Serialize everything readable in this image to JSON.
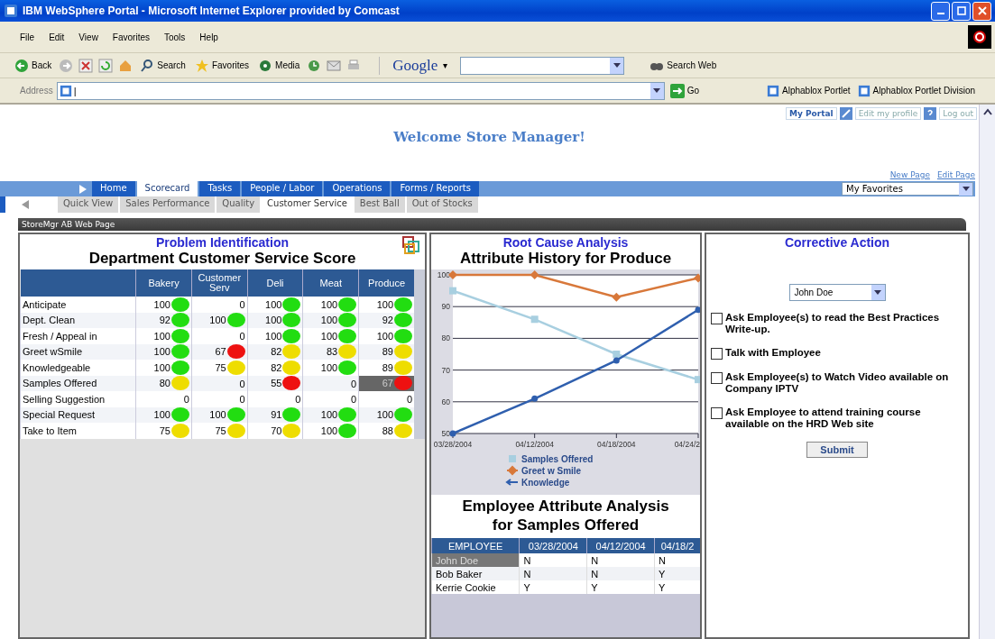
{
  "window": {
    "title": "IBM WebSphere Portal - Microsoft Internet Explorer provided by Comcast"
  },
  "menu": [
    "File",
    "Edit",
    "View",
    "Favorites",
    "Tools",
    "Help"
  ],
  "toolbar": {
    "back": "Back",
    "search": "Search",
    "favorites": "Favorites",
    "media": "Media",
    "google": "Google",
    "google_caret": "▾",
    "search_web": "Search Web"
  },
  "address": {
    "label": "Address",
    "value": "|",
    "go": "Go",
    "links": [
      "Alphablox Portlet",
      "Alphablox Portlet Division"
    ]
  },
  "portal": {
    "top_links": [
      "My Portal",
      "Edit my profile",
      "Log out"
    ],
    "welcome": "Welcome Store Manager!",
    "page_links": [
      "New Page",
      "Edit Page"
    ],
    "nav": [
      {
        "label": "Home",
        "selected": false
      },
      {
        "label": "Scorecard",
        "selected": true
      },
      {
        "label": "Tasks",
        "selected": false
      },
      {
        "label": "People / Labor",
        "selected": false
      },
      {
        "label": "Operations",
        "selected": false
      },
      {
        "label": "Forms / Reports",
        "selected": false
      }
    ],
    "favorites": "My Favorites",
    "subnav": [
      {
        "label": "Quick View",
        "selected": false
      },
      {
        "label": "Sales Performance",
        "selected": false
      },
      {
        "label": "Quality",
        "selected": false
      },
      {
        "label": "Customer Service",
        "selected": true
      },
      {
        "label": "Best Ball",
        "selected": false
      },
      {
        "label": "Out of Stocks",
        "selected": false
      }
    ],
    "portlet_title": "StoreMgr AB Web Page"
  },
  "score": {
    "section_title": "Problem Identification",
    "title": "Department Customer Service Score",
    "columns": [
      "Bakery",
      "Customer Serv",
      "Deli",
      "Meat",
      "Produce"
    ],
    "rows": [
      {
        "label": "Anticipate",
        "cells": [
          {
            "value": "100",
            "color": "#22dd11",
            "selected": false
          },
          {
            "value": "0",
            "selected": false
          },
          {
            "value": "100",
            "color": "#22dd11",
            "selected": false
          },
          {
            "value": "100",
            "color": "#22dd11",
            "selected": false
          },
          {
            "value": "100",
            "color": "#22dd11",
            "selected": false
          }
        ]
      },
      {
        "label": "Dept. Clean",
        "cells": [
          {
            "value": "92",
            "color": "#22dd11",
            "selected": false
          },
          {
            "value": "100",
            "color": "#22dd11",
            "selected": false
          },
          {
            "value": "100",
            "color": "#22dd11",
            "selected": false
          },
          {
            "value": "100",
            "color": "#22dd11",
            "selected": false
          },
          {
            "value": "92",
            "color": "#22dd11",
            "selected": false
          }
        ]
      },
      {
        "label": "Fresh / Appeal in",
        "cells": [
          {
            "value": "100",
            "color": "#22dd11",
            "selected": false
          },
          {
            "value": "0",
            "selected": false
          },
          {
            "value": "100",
            "color": "#22dd11",
            "selected": false
          },
          {
            "value": "100",
            "color": "#22dd11",
            "selected": false
          },
          {
            "value": "100",
            "color": "#22dd11",
            "selected": false
          }
        ]
      },
      {
        "label": "Greet wSmile",
        "cells": [
          {
            "value": "100",
            "color": "#22dd11",
            "selected": false
          },
          {
            "value": "67",
            "color": "#ee1111",
            "selected": false
          },
          {
            "value": "82",
            "color": "#eedd00",
            "selected": false
          },
          {
            "value": "83",
            "color": "#eedd00",
            "selected": false
          },
          {
            "value": "89",
            "color": "#eedd00",
            "selected": false
          }
        ]
      },
      {
        "label": "Knowledgeable",
        "cells": [
          {
            "value": "100",
            "color": "#22dd11",
            "selected": false
          },
          {
            "value": "75",
            "color": "#eedd00",
            "selected": false
          },
          {
            "value": "82",
            "color": "#eedd00",
            "selected": false
          },
          {
            "value": "100",
            "color": "#22dd11",
            "selected": false
          },
          {
            "value": "89",
            "color": "#eedd00",
            "selected": false
          }
        ]
      },
      {
        "label": "Samples Offered",
        "cells": [
          {
            "value": "80",
            "color": "#eedd00",
            "selected": false
          },
          {
            "value": "0",
            "selected": false
          },
          {
            "value": "55",
            "color": "#ee1111",
            "selected": false
          },
          {
            "value": "0",
            "selected": false
          },
          {
            "value": "67",
            "color": "#ee1111",
            "selected": true
          }
        ]
      },
      {
        "label": "Selling Suggestion",
        "cells": [
          {
            "value": "0",
            "selected": false
          },
          {
            "value": "0",
            "selected": false
          },
          {
            "value": "0",
            "selected": false
          },
          {
            "value": "0",
            "selected": false
          },
          {
            "value": "0",
            "selected": false
          }
        ]
      },
      {
        "label": "Special Request",
        "cells": [
          {
            "value": "100",
            "color": "#22dd11",
            "selected": false
          },
          {
            "value": "100",
            "color": "#22dd11",
            "selected": false
          },
          {
            "value": "91",
            "color": "#22dd11",
            "selected": false
          },
          {
            "value": "100",
            "color": "#22dd11",
            "selected": false
          },
          {
            "value": "100",
            "color": "#22dd11",
            "selected": false
          }
        ]
      },
      {
        "label": "Take to Item",
        "cells": [
          {
            "value": "75",
            "color": "#eedd00",
            "selected": false
          },
          {
            "value": "75",
            "color": "#eedd00",
            "selected": false
          },
          {
            "value": "70",
            "color": "#eedd00",
            "selected": false
          },
          {
            "value": "100",
            "color": "#22dd11",
            "selected": false
          },
          {
            "value": "88",
            "color": "#eedd00",
            "selected": false
          }
        ]
      }
    ]
  },
  "root_cause": {
    "section_title": "Root Cause Analysis",
    "title": "Attribute History for Produce",
    "chart_data": {
      "type": "line",
      "grid": true,
      "legend": true,
      "categories": [
        "03/28/2004",
        "04/12/2004",
        "04/18/2004",
        "04/24/2"
      ],
      "ylim": [
        50,
        100
      ],
      "yticks": [
        50,
        60,
        70,
        80,
        90,
        100
      ],
      "series": [
        {
          "name": "Samples Offered",
          "color": "#a8cfe0",
          "marker": "square",
          "values": [
            95,
            86,
            75,
            67
          ]
        },
        {
          "name": "Greet w Smile",
          "color": "#d8783a",
          "marker": "diamond",
          "values": [
            100,
            100,
            93,
            99
          ]
        },
        {
          "name": "Knowledge",
          "color": "#2f5fae",
          "marker": "circle",
          "values": [
            50,
            61,
            73,
            89
          ]
        }
      ]
    }
  },
  "employees": {
    "title": "Employee Attribute Analysis for Samples Offered",
    "columns": [
      "EMPLOYEE",
      "03/28/2004",
      "04/12/2004",
      "04/18/2"
    ],
    "rows": [
      {
        "name": "John Doe",
        "selected": true,
        "values": [
          "N",
          "N",
          "N"
        ]
      },
      {
        "name": "Bob Baker",
        "selected": false,
        "values": [
          "N",
          "N",
          "Y"
        ]
      },
      {
        "name": "Kerrie Cookie",
        "selected": false,
        "values": [
          "Y",
          "Y",
          "Y"
        ]
      }
    ]
  },
  "corrective": {
    "section_title": "Corrective Action",
    "employee": "John Doe",
    "actions": [
      {
        "label": "Ask Employee(s) to read the Best Practices Write-up.",
        "checked": false
      },
      {
        "label": "Talk with Employee",
        "checked": false
      },
      {
        "label": "Ask Employee(s) to Watch Video available on Company IPTV",
        "checked": false
      },
      {
        "label": "Ask Employee to attend training course available on the HRD Web site",
        "checked": false
      }
    ],
    "submit": "Submit"
  }
}
